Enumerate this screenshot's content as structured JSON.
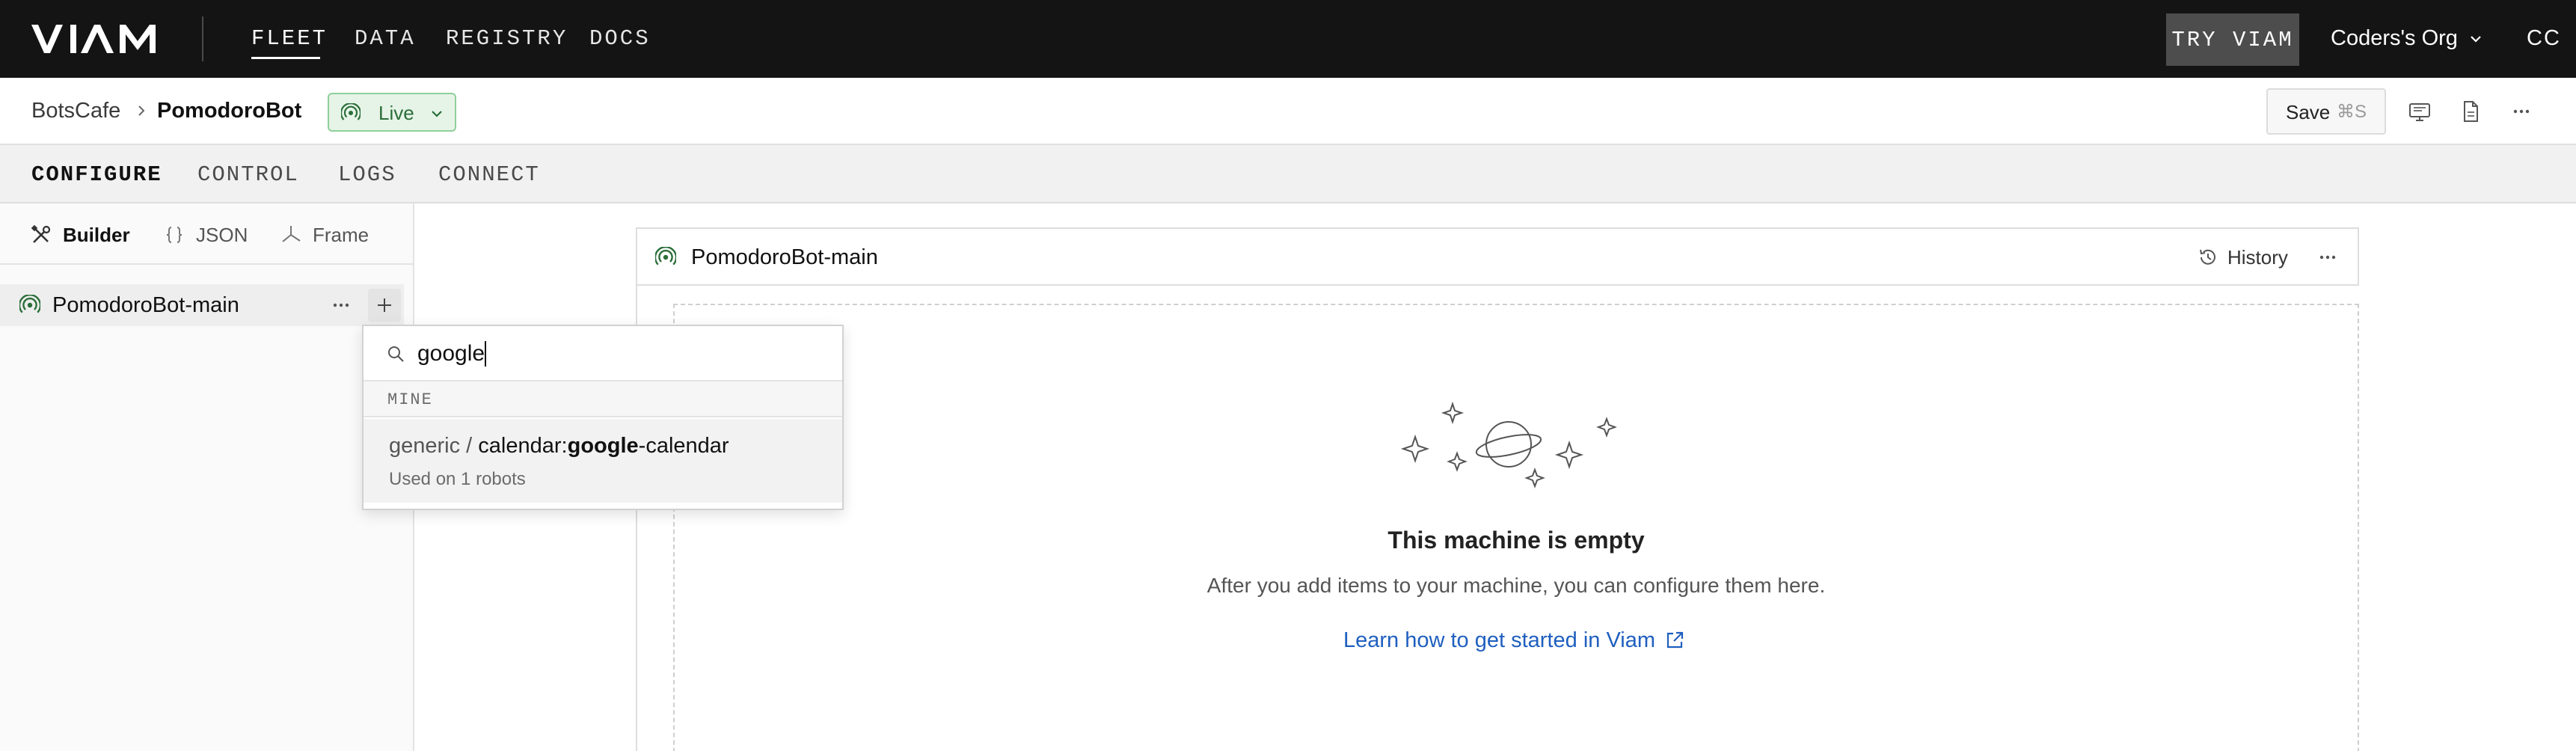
{
  "topnav": {
    "logo": "VIAM",
    "links": [
      {
        "label": "FLEET",
        "active": true
      },
      {
        "label": "DATA",
        "active": false
      },
      {
        "label": "REGISTRY",
        "active": false
      },
      {
        "label": "DOCS",
        "active": false
      }
    ],
    "try_button": "TRY VIAM",
    "org": "Coders's Org",
    "avatar": "CC"
  },
  "breadcrumb": {
    "parent": "BotsCafe",
    "current": "PomodoroBot"
  },
  "status_badge": {
    "label": "Live",
    "color": "#2b6e39"
  },
  "save": {
    "label": "Save",
    "shortcut": "⌘S"
  },
  "tabs": [
    {
      "label": "CONFIGURE",
      "active": true
    },
    {
      "label": "CONTROL",
      "active": false
    },
    {
      "label": "LOGS",
      "active": false
    },
    {
      "label": "CONNECT",
      "active": false
    }
  ],
  "modes": [
    {
      "label": "Builder",
      "icon": "tools-icon",
      "active": true
    },
    {
      "label": "JSON",
      "icon": "braces-icon",
      "active": false
    },
    {
      "label": "Frame",
      "icon": "frame-axes-icon",
      "active": false
    }
  ],
  "tree": {
    "part_name": "PomodoroBot-main"
  },
  "search": {
    "value": "google",
    "section": "MINE",
    "results": [
      {
        "prefix": "generic / ",
        "namespace": "calendar:",
        "match": "google",
        "suffix": "-calendar",
        "usage": "Used on 1 robots"
      }
    ]
  },
  "panel": {
    "title": "PomodoroBot-main",
    "history_label": "History",
    "empty_title": "This machine is empty",
    "empty_subtitle": "After you add items to your machine, you can configure them here.",
    "learn_link": "Learn how to get started in Viam"
  },
  "colors": {
    "topnav_bg": "#141414",
    "live_bg": "#e6f4e8",
    "link": "#1f5fbf"
  }
}
